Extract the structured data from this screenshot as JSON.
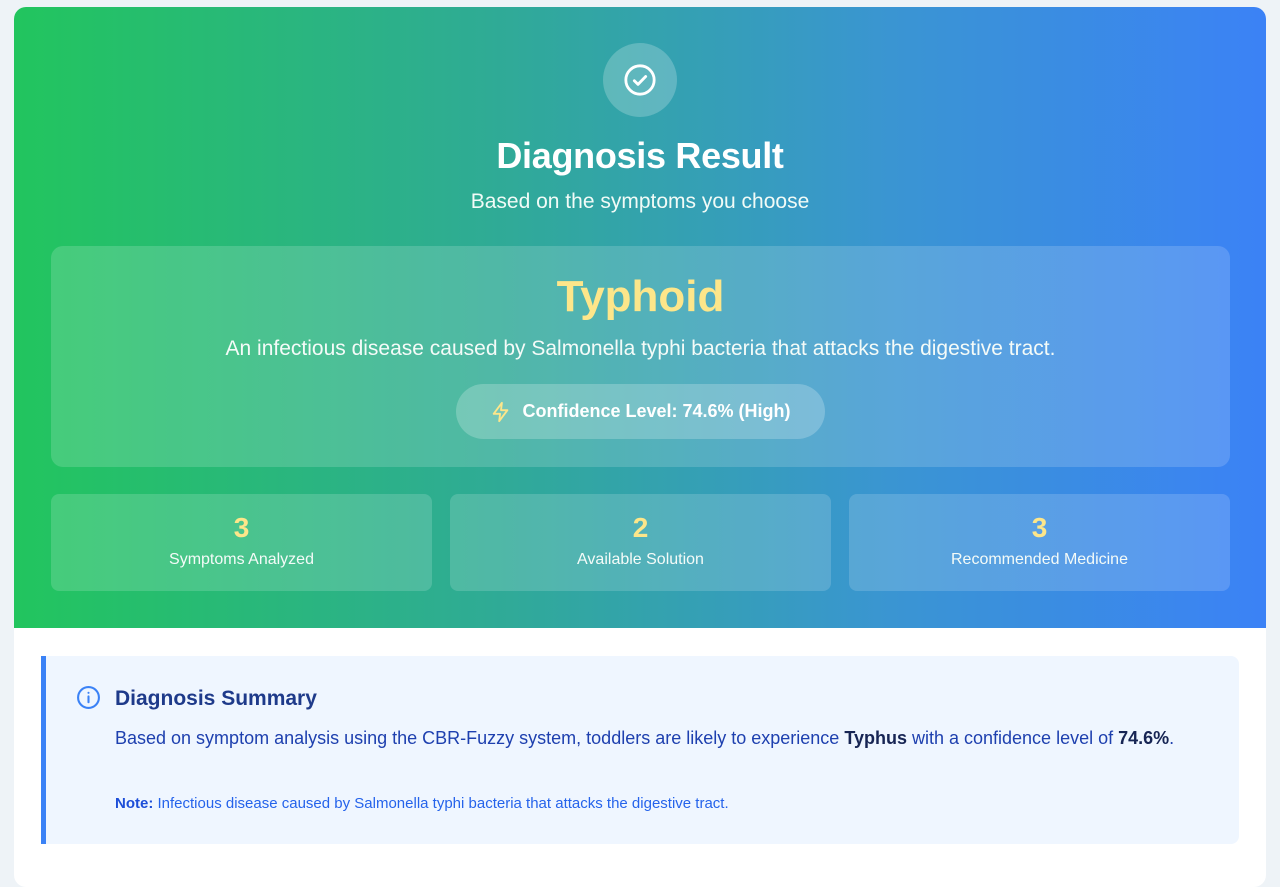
{
  "header": {
    "icon": "check-circle-icon",
    "title": "Diagnosis Result",
    "subtitle": "Based on the symptoms you choose"
  },
  "diagnosis": {
    "disease_name": "Typhoid",
    "description": "An infectious disease caused by Salmonella typhi bacteria that attacks the digestive tract.",
    "confidence_icon": "lightning-icon",
    "confidence_label": "Confidence Level: 74.6% (High)"
  },
  "stats": [
    {
      "value": "3",
      "label": "Symptoms Analyzed"
    },
    {
      "value": "2",
      "label": "Available Solution"
    },
    {
      "value": "3",
      "label": "Recommended Medicine"
    }
  ],
  "summary": {
    "icon": "info-icon",
    "title": "Diagnosis Summary",
    "body_prefix": "Based on symptom analysis using the CBR-Fuzzy system, toddlers are likely to experience ",
    "body_disease": "Typhus",
    "body_middle": " with a confidence level of ",
    "body_confidence": "74.6%",
    "body_suffix": ".",
    "note_label": "Note:",
    "note_text": " Infectious disease caused by Salmonella typhi bacteria that attacks the digestive tract."
  },
  "colors": {
    "gradient_start": "#22c55e",
    "gradient_end": "#3b82f6",
    "highlight": "#fde68a",
    "summary_accent": "#3b82f6",
    "summary_bg": "#eff6ff"
  }
}
